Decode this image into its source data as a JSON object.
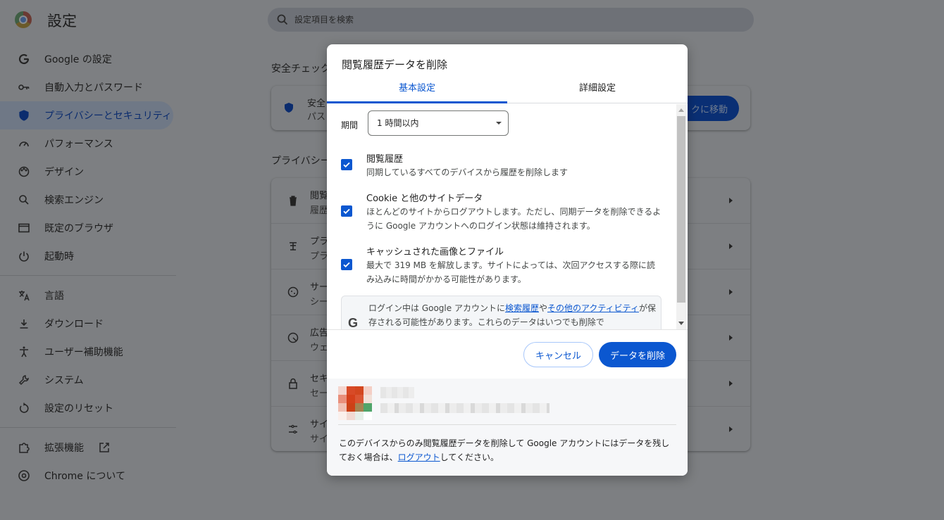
{
  "app": {
    "title": "設定",
    "search_placeholder": "設定項目を検索"
  },
  "sidebar": {
    "items": [
      {
        "label": "Google の設定",
        "icon": "google-g-icon"
      },
      {
        "label": "自動入力とパスワード",
        "icon": "key-icon"
      },
      {
        "label": "プライバシーとセキュリティ",
        "icon": "shield-icon",
        "active": true
      },
      {
        "label": "パフォーマンス",
        "icon": "speedometer-icon"
      },
      {
        "label": "デザイン",
        "icon": "palette-icon"
      },
      {
        "label": "検索エンジン",
        "icon": "search-icon"
      },
      {
        "label": "既定のブラウザ",
        "icon": "browser-window-icon"
      },
      {
        "label": "起動時",
        "icon": "power-icon"
      },
      {
        "label": "言語",
        "icon": "translate-icon"
      },
      {
        "label": "ダウンロード",
        "icon": "download-icon"
      },
      {
        "label": "ユーザー補助機能",
        "icon": "accessibility-icon"
      },
      {
        "label": "システム",
        "icon": "wrench-icon"
      },
      {
        "label": "設定のリセット",
        "icon": "reset-icon"
      },
      {
        "label": "拡張機能",
        "icon": "puzzle-icon"
      },
      {
        "label": "Chrome について",
        "icon": "chrome-icon"
      }
    ]
  },
  "main": {
    "safety_title": "安全チェック",
    "safety_card": {
      "t1": "安全",
      "t2": "パス",
      "button": "クに移動"
    },
    "privacy_title": "プライバシー",
    "rows": [
      {
        "t1": "閲覧",
        "t2": "履歴",
        "icon": "trash-icon"
      },
      {
        "t1": "プラ",
        "t2": "プラ",
        "icon": "cookie-icon"
      },
      {
        "t1": "サー",
        "t2": "シー",
        "icon": "cookie-icon"
      },
      {
        "t1": "広告",
        "t2": "ウェ",
        "icon": "ads-icon"
      },
      {
        "t1": "セキ",
        "t2": "セー",
        "icon": "lock-icon"
      },
      {
        "t1": "サイ",
        "t2": "サイ",
        "icon": "tune-icon"
      }
    ]
  },
  "dialog": {
    "title": "閲覧履歴データを削除",
    "tabs": [
      "基本設定",
      "詳細設定"
    ],
    "period_label": "期間",
    "period_value": "1 時間以内",
    "options": [
      {
        "title": "閲覧履歴",
        "desc": "同期しているすべてのデバイスから履歴を削除します",
        "checked": true
      },
      {
        "title": "Cookie と他のサイトデータ",
        "desc": "ほとんどのサイトからログアウトします。ただし、同期データを削除できるように Google アカウントへのログイン状態は維持されます。",
        "checked": true
      },
      {
        "title": "キャッシュされた画像とファイル",
        "desc": "最大で 319 MB を解放します。サイトによっては、次回アクセスする際に読み込みに時間がかかる可能性があります。",
        "checked": true
      }
    ],
    "google_note": {
      "pre": "ログイン中は Google アカウントに",
      "link1": "検索履歴",
      "mid": "や",
      "link2": "その他のアクティビティ",
      "post": "が保存される可能性があります。これらのデータはいつでも削除で"
    },
    "cancel": "キャンセル",
    "delete": "データを削除",
    "account_note_pre": "このデバイスからのみ閲覧履歴データを削除して Google アカウントにはデータを残しておく場合は、",
    "account_note_link": "ログアウト",
    "account_note_post": "してください。",
    "accent_color": "#0b57d0"
  }
}
